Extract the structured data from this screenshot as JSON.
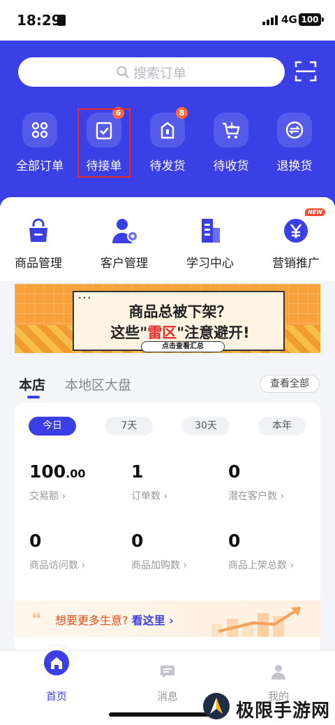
{
  "status_bar": {
    "time": "18:29",
    "network": "4G",
    "battery": "100"
  },
  "search": {
    "placeholder": "搜索订单"
  },
  "order_shortcuts": [
    {
      "label": "全部订单",
      "icon": "grid-icon",
      "badge": ""
    },
    {
      "label": "待接单",
      "icon": "clipboard-check-icon",
      "badge": "6"
    },
    {
      "label": "待发货",
      "icon": "package-icon",
      "badge": "8"
    },
    {
      "label": "待收货",
      "icon": "cart-icon",
      "badge": ""
    },
    {
      "label": "退换货",
      "icon": "exchange-icon",
      "badge": ""
    }
  ],
  "tools": [
    {
      "label": "商品管理",
      "icon": "shopping-bag-icon"
    },
    {
      "label": "客户管理",
      "icon": "user-settings-icon"
    },
    {
      "label": "学习中心",
      "icon": "building-icon"
    },
    {
      "label": "营销推广",
      "icon": "yen-coin-icon",
      "tag": "NEW"
    }
  ],
  "banner": {
    "dots": "•••",
    "line1": "商品总被下架？",
    "line2_pre": "这些\"",
    "line2_hot": "雷区",
    "line2_post": "\"注意避开!",
    "button": "点击查看汇总"
  },
  "store_tabs": {
    "active": "本店",
    "other": "本地区大盘",
    "view_all": "查看全部"
  },
  "periods": [
    "今日",
    "7天",
    "30天",
    "本年"
  ],
  "metrics": [
    {
      "value": "100",
      "decimal": ".00",
      "label": "交易额 ›"
    },
    {
      "value": "1",
      "decimal": "",
      "label": "订单数 ›"
    },
    {
      "value": "0",
      "decimal": "",
      "label": "潜在客户数 ›"
    },
    {
      "value": "0",
      "decimal": "",
      "label": "商品访问数 ›"
    },
    {
      "value": "0",
      "decimal": "",
      "label": "商品加购数 ›"
    },
    {
      "value": "0",
      "decimal": "",
      "label": "商品上架总数 ›"
    }
  ],
  "promo": {
    "quote": "❝",
    "text": "想要更多生意?",
    "link": "看这里 ›"
  },
  "tabbar": [
    {
      "label": "首页",
      "icon": "home-icon",
      "active": true
    },
    {
      "label": "消息",
      "icon": "message-icon",
      "active": false
    },
    {
      "label": "我的",
      "icon": "user-icon",
      "active": false
    }
  ],
  "watermark": {
    "text": "极限手游网"
  },
  "colors": {
    "brand": "#3a3fe6",
    "badge": "#ff6a3d",
    "highlight": "#e82a2a",
    "promo_text": "#e0501e"
  }
}
